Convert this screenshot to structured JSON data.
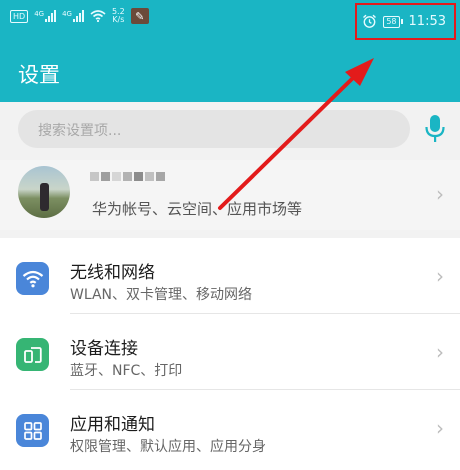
{
  "status_bar": {
    "hd_badge": "HD",
    "signal1_label": "4G",
    "signal2_label": "4G",
    "speed_value": "5.2",
    "speed_unit": "K/s",
    "battery": "58",
    "time": "11:53",
    "highlight_color": "#e31b1b"
  },
  "header": {
    "title": "设置",
    "bg_color": "#1ab5c4"
  },
  "search": {
    "placeholder": "搜索设置项..."
  },
  "account": {
    "subtitle": "华为帐号、云空间、应用市场等"
  },
  "settings_items": [
    {
      "icon": "wifi-icon",
      "title": "无线和网络",
      "subtitle": "WLAN、双卡管理、移动网络",
      "icon_color": "#4a86d9"
    },
    {
      "icon": "device-connection-icon",
      "title": "设备连接",
      "subtitle": "蓝牙、NFC、打印",
      "icon_color": "#36b574"
    },
    {
      "icon": "apps-grid-icon",
      "title": "应用和通知",
      "subtitle": "权限管理、默认应用、应用分身",
      "icon_color": "#4a86d9"
    }
  ],
  "annotation": {
    "arrow_color": "#e31b1b"
  }
}
